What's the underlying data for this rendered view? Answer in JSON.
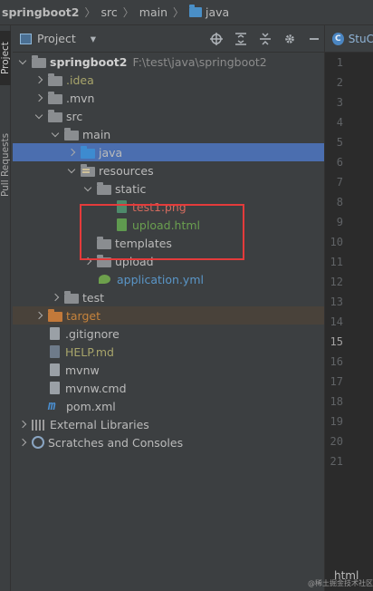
{
  "breadcrumb": {
    "project": "springboot2",
    "src": "src",
    "main": "main",
    "java": "java"
  },
  "side_tabs": {
    "project": "Project",
    "pull_requests": "Pull Requests"
  },
  "panel": {
    "title": "Project",
    "dropdown_glyph": "▾"
  },
  "tree": {
    "root": {
      "label": "springboot2",
      "path": "F:\\test\\java\\springboot2"
    },
    "idea": ".idea",
    "mvn": ".mvn",
    "src": "src",
    "main": "main",
    "java": "java",
    "resources": "resources",
    "static": "static",
    "test1": "test1.png",
    "upload_html": "upload.html",
    "templates": "templates",
    "upload": "upload",
    "application": "application.yml",
    "test": "test",
    "target": "target",
    "gitignore": ".gitignore",
    "help": "HELP.md",
    "mvnw": "mvnw",
    "mvnw_cmd": "mvnw.cmd",
    "pom": "pom.xml",
    "external_libraries": "External Libraries",
    "scratches": "Scratches and Consoles"
  },
  "editor": {
    "tab_label": "StuC",
    "line_numbers": [
      "1",
      "2",
      "3",
      "4",
      "5",
      "6",
      "7",
      "8",
      "9",
      "10",
      "11",
      "12",
      "13",
      "14",
      "15",
      "16",
      "17",
      "18",
      "19",
      "20",
      "21"
    ],
    "current_line": "15",
    "bottom_label": "html"
  },
  "watermark": "@稀土掘金技术社区",
  "colors": {
    "background": "#3c3f41",
    "editor_background": "#2b2b2b",
    "selection": "#4b6eaf",
    "highlight_box": "#e43b3b"
  }
}
